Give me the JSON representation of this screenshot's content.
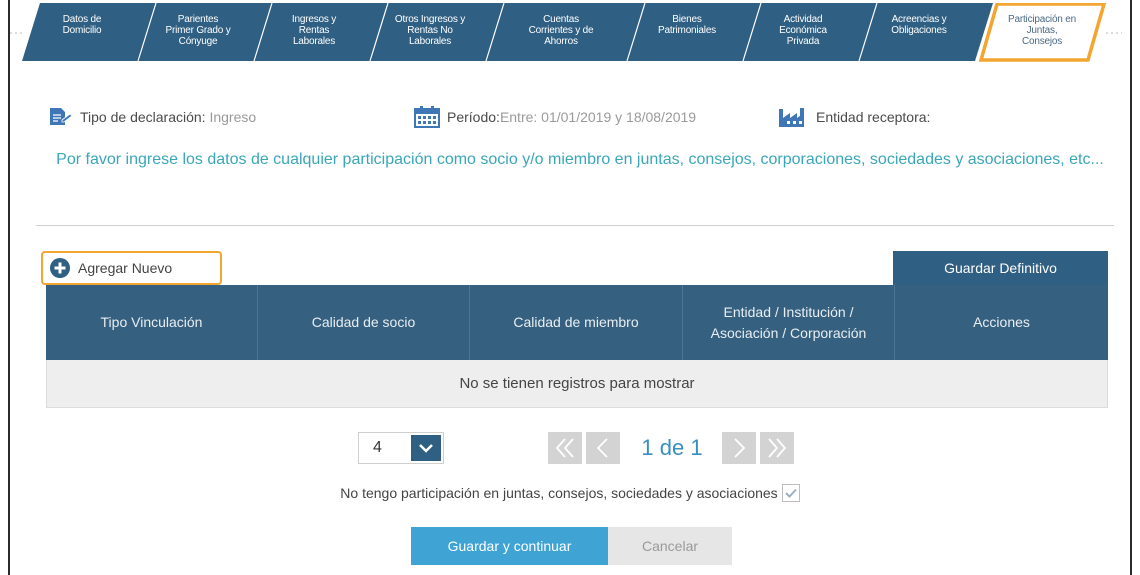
{
  "steps": [
    {
      "label": "Datos de\nDomicilio"
    },
    {
      "label": "Parientes\nPrimer Grado y\nCónyuge"
    },
    {
      "label": "Ingresos y\nRentas\nLaborales"
    },
    {
      "label": "Otros Ingresos y\nRentas No\nLaborales"
    },
    {
      "label": "Cuentas\nCorrientes y de\nAhorros"
    },
    {
      "label": "Bienes\nPatrimoniales"
    },
    {
      "label": "Actividad\nEconómica\nPrivada"
    },
    {
      "label": "Acreencias y\nObligaciones"
    },
    {
      "label": "Participación en\nJuntas,\nConsejos"
    }
  ],
  "active_step_index": 8,
  "info": {
    "tipo_label": "Tipo de declaración:",
    "tipo_value": "Ingreso",
    "periodo_label": "Período:",
    "periodo_value": "Entre: 01/01/2019 y 18/08/2019",
    "entidad_label": "Entidad receptora:"
  },
  "instructions": "Por favor ingrese los datos de cualquier participación como socio y/o miembro en juntas, consejos, corporaciones, sociedades y asociaciones, etc...",
  "actions": {
    "add_new": "Agregar Nuevo",
    "save_final": "Guardar Definitivo"
  },
  "table": {
    "columns": [
      "Tipo Vinculación",
      "Calidad de socio",
      "Calidad de miembro",
      "Entidad / Institución /\nAsociación / Corporación",
      "Acciones"
    ],
    "empty_message": "No se tienen registros para mostrar"
  },
  "pagination": {
    "page_size": "4",
    "indicator": "1 de 1"
  },
  "no_participation_label": "No tengo participación en juntas, consejos, sociedades y asociaciones",
  "buttons": {
    "save_continue": "Guardar y continuar",
    "cancel": "Cancelar"
  },
  "colors": {
    "tab_blue": "#2f5f82",
    "highlight": "#f2a531",
    "accent_teal": "#3aa7b8",
    "primary_button": "#3fa3d4"
  }
}
